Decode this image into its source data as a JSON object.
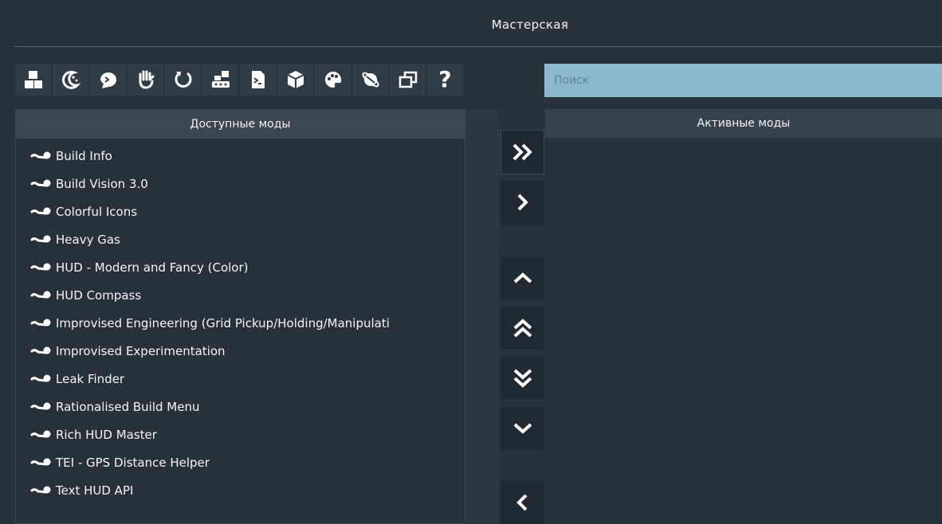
{
  "window": {
    "title": "Мастерская"
  },
  "toolbar": {
    "buttons": [
      {
        "icon": "blocks-icon"
      },
      {
        "icon": "moon-stars-icon"
      },
      {
        "icon": "chat-bubble-icon"
      },
      {
        "icon": "hand-icon"
      },
      {
        "icon": "refresh-icon"
      },
      {
        "icon": "factory-icon"
      },
      {
        "icon": "script-icon"
      },
      {
        "icon": "box-icon"
      },
      {
        "icon": "palette-icon"
      },
      {
        "icon": "planet-icon"
      },
      {
        "icon": "windows-icon"
      },
      {
        "icon": "help-icon",
        "label": "?"
      }
    ]
  },
  "search": {
    "placeholder": "Поиск",
    "value": ""
  },
  "available": {
    "header": "Доступные моды",
    "items": [
      "Build Info",
      "Build Vision 3.0",
      "Colorful Icons",
      "Heavy Gas",
      "HUD - Modern and Fancy (Color)",
      "HUD Compass",
      "Improvised Engineering (Grid Pickup/Holding/Manipulati",
      "Improvised Experimentation",
      "Leak Finder",
      "Rationalised Build Menu",
      "Rich HUD Master",
      "TEI - GPS Distance Helper",
      "Text HUD API"
    ]
  },
  "active": {
    "header": "Активные моды",
    "items": []
  },
  "arrows": [
    "add-all",
    "add",
    "move-up",
    "move-top",
    "move-bottom",
    "move-down",
    "remove"
  ],
  "colors": {
    "background": "#27323b",
    "search_bg": "#8ab9cc",
    "header_bg": "#3a4751"
  }
}
